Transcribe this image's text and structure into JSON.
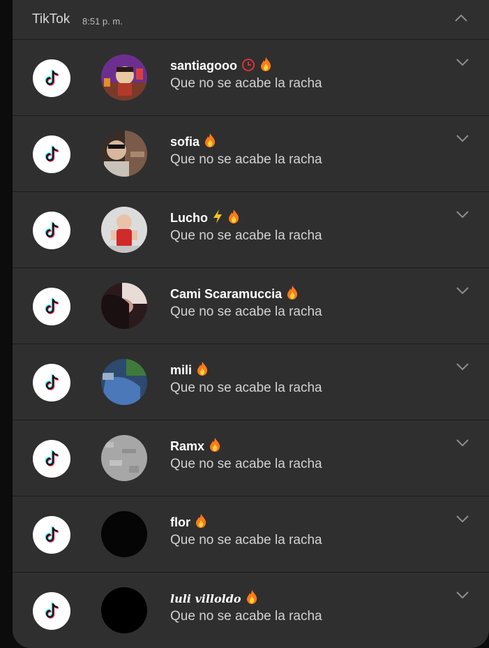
{
  "header": {
    "app_name": "TikTok",
    "time": "8:51 p. m."
  },
  "colors": {
    "panel": "#2f2f30",
    "text_primary": "#ffffff",
    "text_secondary": "#d2d2d2",
    "tiktok_cyan": "#25f4ee",
    "tiktok_pink": "#fe2c55",
    "fire": "#ff7a1a"
  },
  "notifications": [
    {
      "sender": "santiagooo",
      "badges": [
        "clock-icon",
        "fire-icon"
      ],
      "message": "Que no se acabe la racha"
    },
    {
      "sender": "sofia",
      "badges": [
        "fire-icon"
      ],
      "message": "Que no se acabe la racha"
    },
    {
      "sender": "Lucho",
      "badges": [
        "lightning-icon",
        "fire-icon"
      ],
      "message": "Que no se acabe la racha"
    },
    {
      "sender": "Cami Scaramuccia",
      "badges": [
        "fire-icon"
      ],
      "message": "Que no se acabe la racha"
    },
    {
      "sender": "mili",
      "badges": [
        "fire-icon"
      ],
      "message": "Que no se acabe la racha"
    },
    {
      "sender": "Ramx",
      "badges": [
        "fire-icon"
      ],
      "message": "Que no se acabe la racha"
    },
    {
      "sender": "flor",
      "badges": [
        "fire-icon"
      ],
      "message": "Que no se acabe la racha"
    },
    {
      "sender": "luli villoldo",
      "badges": [
        "fire-icon"
      ],
      "message": "Que no se acabe la racha"
    }
  ]
}
